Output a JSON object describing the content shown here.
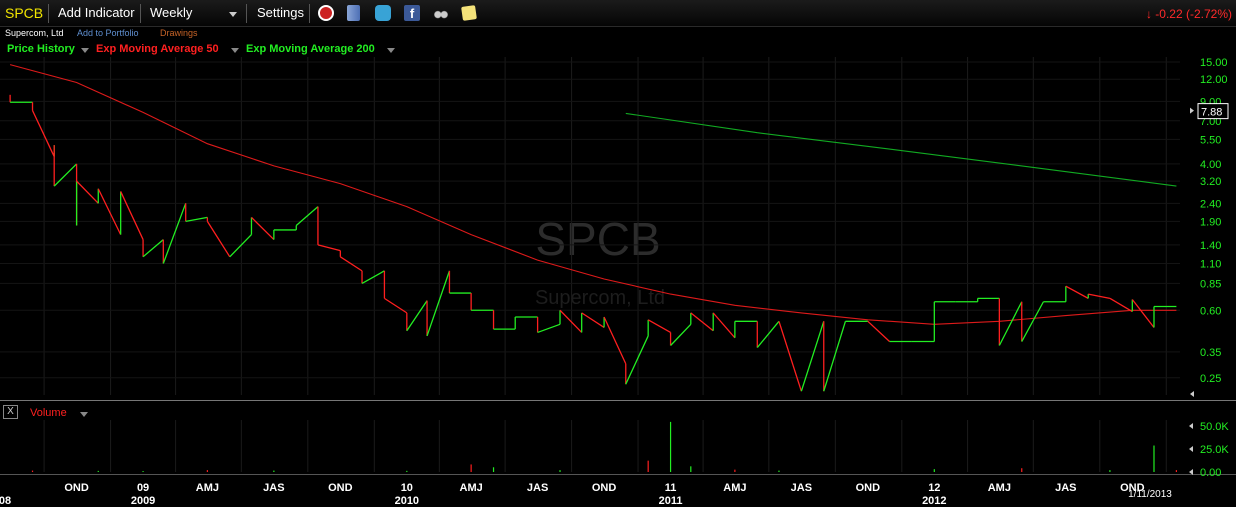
{
  "toolbar": {
    "ticker": "SPCB",
    "add_indicator": "Add Indicator",
    "interval": "Weekly",
    "settings": "Settings",
    "change_arrow": "↓",
    "change": "-0.22 (-2.72%)",
    "icons": [
      "alarm-clock-icon",
      "book-icon",
      "twitter-icon",
      "facebook-icon",
      "binoculars-icon",
      "note-icon"
    ]
  },
  "subbar": {
    "company": "Supercom, Ltd",
    "add_to_portfolio": "Add to Portfolio",
    "drawings": "Drawings"
  },
  "legend": {
    "price": "Price History",
    "ema50": "Exp Moving Average 50",
    "ema200": "Exp Moving Average 200"
  },
  "watermark": {
    "ticker": "SPCB",
    "company": "Supercom, Ltd"
  },
  "volume_panel": {
    "close": "X",
    "label": "Volume"
  },
  "colors": {
    "up": "#22ee22",
    "down": "#ff1f1f",
    "ema50": "#dd1a1a",
    "ema200": "#11aa22",
    "axis_text": "#22ee22",
    "grid": "#1b1b1b"
  },
  "chart_data": {
    "type": "line",
    "scale": "log",
    "price_ticks": [
      "15.00",
      "12.00",
      "9.00",
      "7.00",
      "5.50",
      "4.00",
      "3.20",
      "2.40",
      "1.90",
      "1.40",
      "1.10",
      "0.85",
      "0.60",
      "0.35",
      "0.25"
    ],
    "last_price": "7.88",
    "volume_ticks": [
      "50.0K",
      "25.0K",
      "0.00"
    ],
    "x_month_labels": [
      "OND",
      "09",
      "AMJ",
      "JAS",
      "OND",
      "10",
      "AMJ",
      "JAS",
      "OND",
      "11",
      "AMJ",
      "JAS",
      "OND",
      "12",
      "AMJ",
      "JAS",
      "OND"
    ],
    "x_year_labels": [
      "08",
      "2009",
      "2010",
      "2011",
      "2012"
    ],
    "date_label": "1/11/2013",
    "x_range": [
      "2008-08",
      "2013-01"
    ],
    "ylim": [
      0.2,
      16
    ],
    "series": [
      {
        "name": "Price History",
        "type": "up-down-colored",
        "x": [
          "2008-08",
          "2008-08",
          "2008-09",
          "2008-09",
          "2008-09",
          "2008-10",
          "2008-10",
          "2008-10",
          "2008-11",
          "2008-11",
          "2008-11",
          "2008-12",
          "2008-12",
          "2009-01",
          "2009-01",
          "2009-02",
          "2009-02",
          "2009-03",
          "2009-03",
          "2009-04",
          "2009-04",
          "2009-05",
          "2009-05",
          "2009-06",
          "2009-06",
          "2009-07",
          "2009-07",
          "2009-08",
          "2009-08",
          "2009-09",
          "2009-09",
          "2009-10",
          "2009-10",
          "2009-11",
          "2009-11",
          "2009-12",
          "2009-12",
          "2010-01",
          "2010-01",
          "2010-02",
          "2010-02",
          "2010-03",
          "2010-03",
          "2010-04",
          "2010-04",
          "2010-05",
          "2010-05",
          "2010-06",
          "2010-06",
          "2010-07",
          "2010-07",
          "2010-08",
          "2010-08",
          "2010-09",
          "2010-09",
          "2010-10",
          "2010-10",
          "2010-11",
          "2010-11",
          "2010-12",
          "2010-12",
          "2011-01",
          "2011-01",
          "2011-02",
          "2011-02",
          "2011-03",
          "2011-03",
          "2011-04",
          "2011-04",
          "2011-05",
          "2011-05",
          "2011-06",
          "2011-06",
          "2011-07",
          "2011-08",
          "2011-09",
          "2011-09",
          "2011-10",
          "2011-10",
          "2011-11",
          "2011-12",
          "2011-12",
          "2012-01",
          "2012-02",
          "2012-02",
          "2012-03",
          "2012-04",
          "2012-04",
          "2012-05",
          "2012-05",
          "2012-06",
          "2012-06",
          "2012-07",
          "2012-08",
          "2012-08",
          "2012-09",
          "2012-09",
          "2012-10",
          "2012-10",
          "2012-11",
          "2012-11",
          "2012-12",
          "2012-12",
          "2013-01"
        ],
        "y": [
          9.8,
          8.9,
          8.9,
          8.1,
          8.0,
          4.4,
          5.1,
          3.0,
          4.0,
          1.8,
          3.2,
          2.4,
          2.9,
          1.6,
          2.8,
          1.5,
          1.2,
          1.5,
          1.1,
          2.4,
          1.9,
          2.0,
          1.9,
          1.2,
          1.2,
          1.6,
          2.0,
          1.5,
          1.7,
          1.7,
          1.8,
          2.3,
          1.4,
          1.3,
          1.2,
          1.0,
          0.85,
          1.0,
          0.7,
          0.58,
          0.46,
          0.68,
          0.43,
          1.0,
          0.75,
          0.75,
          0.6,
          0.6,
          0.47,
          0.47,
          0.55,
          0.55,
          0.45,
          0.5,
          0.6,
          0.45,
          0.58,
          0.48,
          0.55,
          0.3,
          0.23,
          0.43,
          0.53,
          0.45,
          0.38,
          0.5,
          0.58,
          0.46,
          0.58,
          0.42,
          0.52,
          0.52,
          0.37,
          0.52,
          0.21,
          0.52,
          0.21,
          0.52,
          0.52,
          0.52,
          0.4,
          0.4,
          0.4,
          0.4,
          0.67,
          0.67,
          0.67,
          0.7,
          0.7,
          0.38,
          0.67,
          0.4,
          0.67,
          0.67,
          0.82,
          0.7,
          0.74,
          0.7,
          0.7,
          0.59,
          0.69,
          0.48,
          0.63,
          0.63
        ]
      },
      {
        "name": "Exp Moving Average 50",
        "x": [
          "2008-08",
          "2008-11",
          "2009-02",
          "2009-05",
          "2009-08",
          "2009-11",
          "2010-02",
          "2010-05",
          "2010-08",
          "2010-11",
          "2011-02",
          "2011-05",
          "2011-08",
          "2011-11",
          "2012-02",
          "2012-05",
          "2012-08",
          "2012-11",
          "2013-01"
        ],
        "y": [
          14.5,
          11.5,
          7.8,
          5.2,
          3.9,
          3.1,
          2.3,
          1.6,
          1.15,
          0.9,
          0.74,
          0.64,
          0.58,
          0.53,
          0.5,
          0.52,
          0.56,
          0.6,
          0.6
        ]
      },
      {
        "name": "Exp Moving Average 200",
        "x": [
          "2010-12",
          "2011-06",
          "2011-12",
          "2012-06",
          "2013-01"
        ],
        "y": [
          7.7,
          6.0,
          4.85,
          3.9,
          3.0
        ]
      },
      {
        "name": "Volume",
        "x": [
          "2008-09",
          "2008-12",
          "2009-02",
          "2009-05",
          "2009-08",
          "2010-02",
          "2010-05",
          "2010-06",
          "2010-09",
          "2011-01",
          "2011-02",
          "2011-03",
          "2011-05",
          "2011-07",
          "2012-02",
          "2012-06",
          "2012-10",
          "2012-12",
          "2013-01"
        ],
        "values": [
          1500,
          1200,
          1000,
          2000,
          1500,
          1200,
          8000,
          5000,
          2000,
          12000,
          53000,
          6000,
          2500,
          1500,
          3000,
          4000,
          2000,
          28000,
          2000
        ]
      }
    ]
  }
}
